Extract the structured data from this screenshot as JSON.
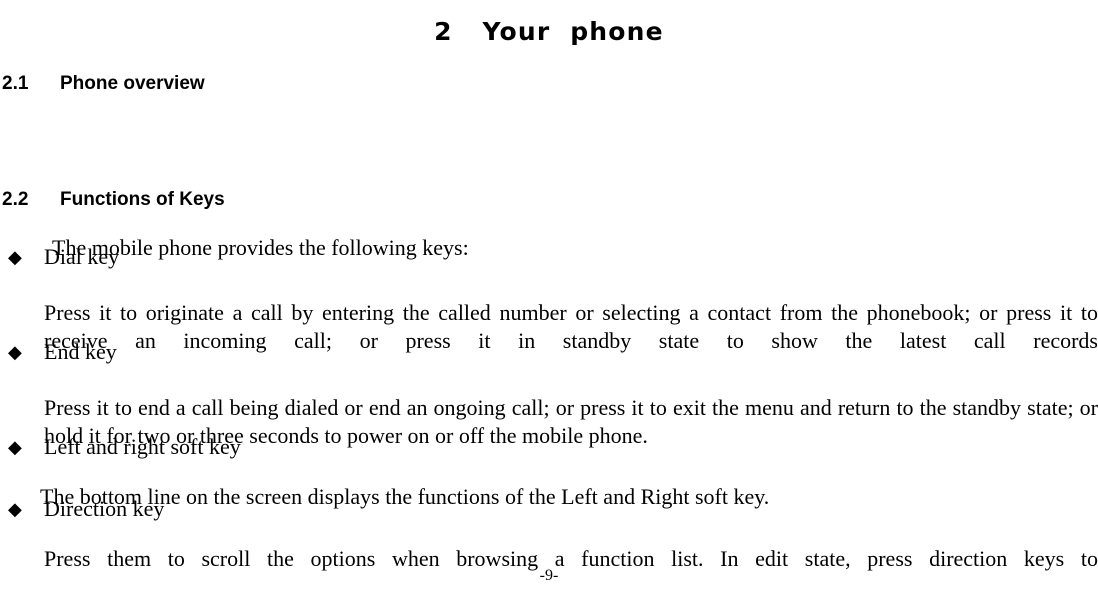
{
  "document": {
    "chapter_title": "2   Your  phone",
    "page_number_footer": "-9-"
  },
  "sections": {
    "overview": {
      "number": "2.1",
      "title": "Phone overview"
    },
    "functions": {
      "number": "2.2",
      "title": "Functions of Keys",
      "intro": "The mobile phone provides the following keys:"
    }
  },
  "bullets": {
    "marker_glyph": "◆",
    "marker_name": "diamond-bullet-icon",
    "items": [
      {
        "label": "Dial key",
        "body": "Press it to originate a call by entering the called number or selecting a contact from the phonebook; or press it to receive an incoming call; or press it in standby state to show the latest call records"
      },
      {
        "label": "End key",
        "body": "Press it to end a call being dialed or end an ongoing call; or press it to exit the menu and return to the standby state; or hold it for two or three seconds to power on or off the mobile phone."
      },
      {
        "label": "Left and right soft key",
        "body": "The bottom line on the screen displays the functions of the Left and Right soft key."
      },
      {
        "label": "Direction key",
        "body": "Press them to scroll the options when browsing a function list. In edit state, press direction keys to"
      }
    ]
  },
  "colors": {
    "background": "#ffffff",
    "text": "#000000"
  }
}
